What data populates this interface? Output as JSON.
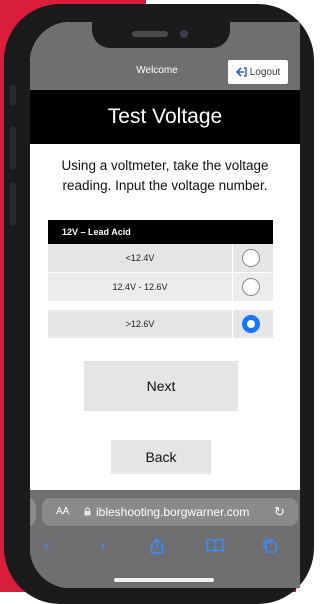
{
  "header": {
    "welcome": "Welcome",
    "logout_label": "Logout"
  },
  "page": {
    "title": "Test Voltage",
    "instruction": "Using a voltmeter, take the voltage reading. Input the voltage number."
  },
  "battery_table": {
    "header": "12V – Lead Acid",
    "options": [
      {
        "label": "<12.4V",
        "selected": false
      },
      {
        "label": "12.4V - 12.6V",
        "selected": false
      },
      {
        "label": ">12.6V",
        "selected": true
      }
    ]
  },
  "buttons": {
    "next_label": "Next",
    "back_label": "Back"
  },
  "browser": {
    "aa_label": "AA",
    "url": "ibleshooting.borgwarner.com",
    "lock_icon": "lock-icon",
    "reload_icon": "reload-icon"
  },
  "colors": {
    "brand_red": "#d81e3a",
    "selected_blue": "#1677ff",
    "ios_blue": "#3b8cff"
  }
}
